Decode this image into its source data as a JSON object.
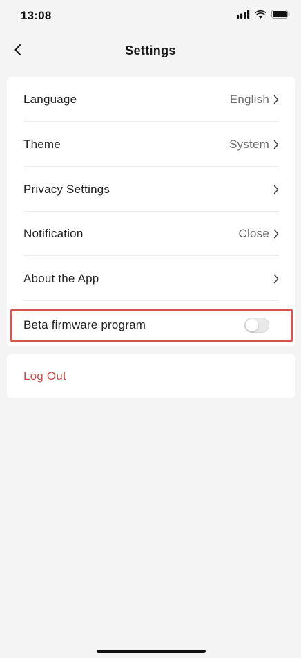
{
  "status_bar": {
    "time": "13:08",
    "icons": [
      "cellular-signal-icon",
      "wifi-icon",
      "battery-icon"
    ]
  },
  "nav": {
    "title": "Settings",
    "back_icon": "chevron-left-icon"
  },
  "settings": {
    "items": [
      {
        "label": "Language",
        "value": "English"
      },
      {
        "label": "Theme",
        "value": "System"
      },
      {
        "label": "Privacy Settings",
        "value": ""
      },
      {
        "label": "Notification",
        "value": "Close"
      },
      {
        "label": "About the App",
        "value": ""
      }
    ],
    "beta": {
      "label": "Beta firmware program",
      "enabled": false
    }
  },
  "logout": {
    "label": "Log Out"
  },
  "colors": {
    "background": "#f4f4f4",
    "card": "#ffffff",
    "logout_text": "#cd4a48",
    "highlight_border": "#d9534f",
    "secondary_text": "#6b6b6b"
  }
}
